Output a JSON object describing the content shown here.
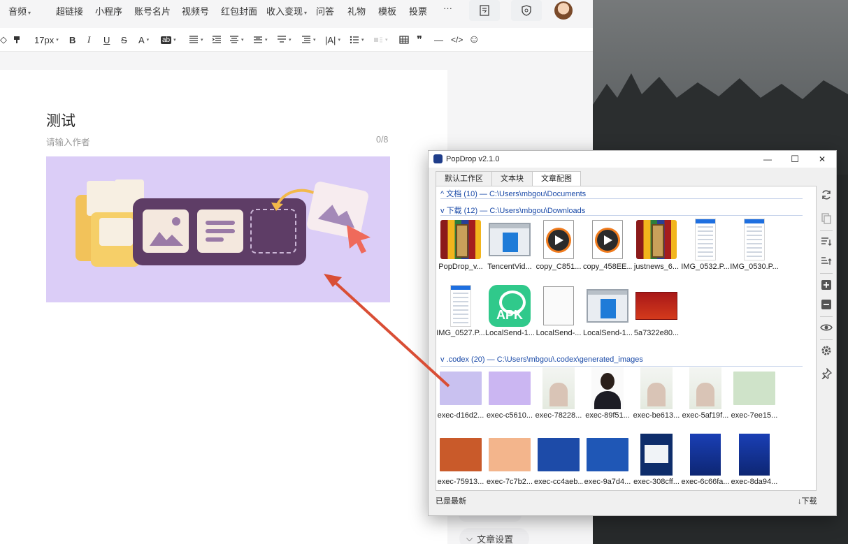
{
  "editor": {
    "nav": {
      "items": [
        "音频",
        "超链接",
        "小程序",
        "账号名片",
        "视频号",
        "红包封面",
        "收入变现",
        "问答",
        "礼物",
        "模板",
        "投票"
      ],
      "more": "···"
    },
    "toolbar": {
      "font_size": "17px",
      "bold": "B",
      "italic": "I",
      "underline": "U",
      "strike": "S",
      "font_color": "A",
      "bg_color": "ab",
      "letter_spacing": "|A|",
      "quote": "❞",
      "hr": "—",
      "code": "</>",
      "emoji": "☺"
    },
    "article": {
      "title": "测试",
      "author_placeholder": "请输入作者",
      "author_count": "0/8"
    },
    "settings_label": "文章设置"
  },
  "popdrop": {
    "title": "PopDrop v2.1.0",
    "controls": {
      "minimize": "—",
      "maximize": "☐",
      "close": "✕"
    },
    "tabs": [
      "默认工作区",
      "文本块",
      "文章配图"
    ],
    "active_tab": 2,
    "groups": [
      {
        "chevron": "^",
        "name": "文档 (10)",
        "sep": "—",
        "path": "C:\\Users\\mbgou\\Documents"
      },
      {
        "chevron": "v",
        "name": "下载 (12)",
        "sep": "—",
        "path": "C:\\Users\\mbgou\\Downloads"
      },
      {
        "chevron": "v",
        "name": ".codex (20)",
        "sep": "—",
        "path": "C:\\Users\\mbgou\\.codex\\generated_images"
      }
    ],
    "downloads": [
      {
        "label": "PopDrop_v...",
        "kind": "rar"
      },
      {
        "label": "TencentVid...",
        "kind": "winapp"
      },
      {
        "label": "copy_C851...",
        "kind": "media"
      },
      {
        "label": "copy_458EE...",
        "kind": "media"
      },
      {
        "label": "justnews_6...",
        "kind": "rar"
      },
      {
        "label": "IMG_0532.P...",
        "kind": "phone"
      },
      {
        "label": "IMG_0530.P...",
        "kind": "phone"
      },
      {
        "label": "IMG_0527.P...",
        "kind": "phone"
      },
      {
        "label": "LocalSend-1...",
        "kind": "apk",
        "badge": "APK"
      },
      {
        "label": "LocalSend-...",
        "kind": "doc"
      },
      {
        "label": "LocalSend-1...",
        "kind": "winapp"
      },
      {
        "label": "5a7322e80...",
        "kind": "redimg"
      }
    ],
    "codex": [
      {
        "label": "exec-d16d2...",
        "kind": "img",
        "color": "#c9c1f0"
      },
      {
        "label": "exec-c5610...",
        "kind": "img",
        "color": "#cbb6f2"
      },
      {
        "label": "exec-78228...",
        "kind": "poster"
      },
      {
        "label": "exec-89f51...",
        "kind": "portrait"
      },
      {
        "label": "exec-be613...",
        "kind": "poster"
      },
      {
        "label": "exec-5af19f...",
        "kind": "poster"
      },
      {
        "label": "exec-7ee15...",
        "kind": "img",
        "color": "#cfe3c9"
      },
      {
        "label": "exec-75913...",
        "kind": "img",
        "color": "#c95a2a"
      },
      {
        "label": "exec-7c7b2...",
        "kind": "img",
        "color": "#f3b58c"
      },
      {
        "label": "exec-cc4aeb...",
        "kind": "img",
        "color": "#1d4ba8"
      },
      {
        "label": "exec-9a7d4...",
        "kind": "img",
        "color": "#1f57b6"
      },
      {
        "label": "exec-308cff...",
        "kind": "dark"
      },
      {
        "label": "exec-6c66fa...",
        "kind": "bluecard"
      },
      {
        "label": "exec-8da94...",
        "kind": "bluecard"
      }
    ],
    "status": "已是最新",
    "download_label": "↓下载"
  }
}
